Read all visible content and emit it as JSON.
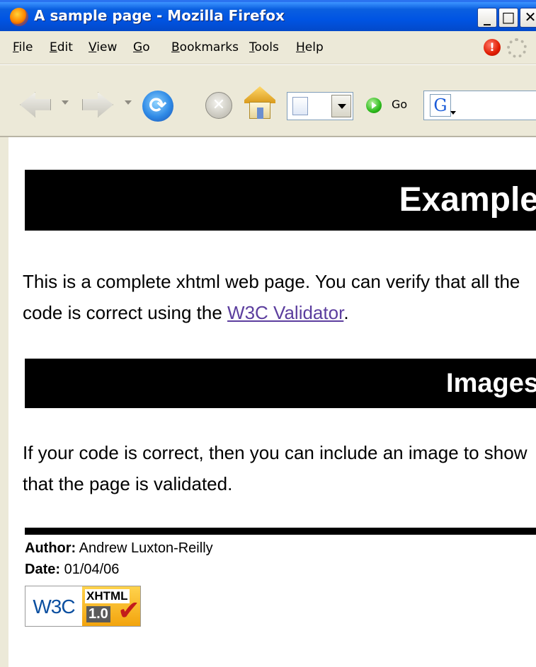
{
  "window": {
    "title": "A sample page - Mozilla Firefox",
    "minimize": "_",
    "maximize": "□",
    "close": "✕"
  },
  "menu": {
    "items": [
      "File",
      "Edit",
      "View",
      "Go",
      "Bookmarks",
      "Tools",
      "Help"
    ]
  },
  "toolbar": {
    "go_label": "Go",
    "search_engine_glyph": "G",
    "reload_glyph": "⟳",
    "stop_glyph": "✕",
    "alert_glyph": "!"
  },
  "page": {
    "heading1": "Example",
    "intro_text": "This is a complete xhtml web page. You can verify that all the code is correct using the ",
    "validator_link": "W3C Validator",
    "intro_end": ".",
    "heading2": "Images",
    "images_text": "If your code is correct, then you can include an image to show that the page is validated.",
    "author_label": "Author:",
    "author_name": " Andrew Luxton-Reilly",
    "date_label": "Date:",
    "date_value": " 01/04/06",
    "badge": {
      "logo": "W3C",
      "type": "XHTML",
      "version": "1.0",
      "check": "✔"
    }
  }
}
